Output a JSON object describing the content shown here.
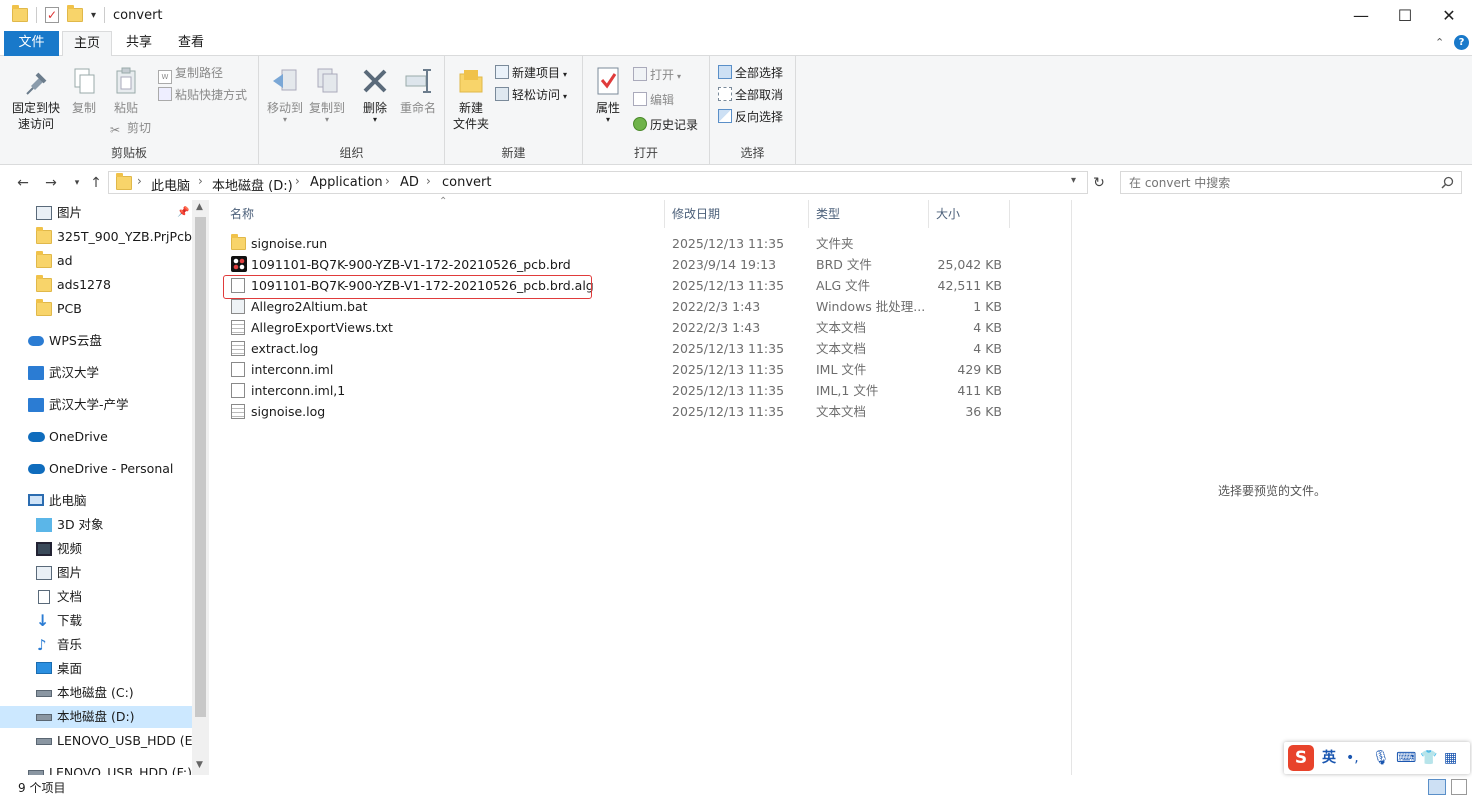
{
  "window": {
    "title": "convert",
    "controls": {
      "minimize": "—",
      "maximize": "☐",
      "close": "✕"
    }
  },
  "menu_tabs": [
    {
      "label": "文件",
      "active": false,
      "accent": true
    },
    {
      "label": "主页",
      "active": true
    },
    {
      "label": "共享",
      "active": false
    },
    {
      "label": "查看",
      "active": false
    }
  ],
  "ribbon": {
    "clipboard": {
      "label": "剪贴板",
      "pin": "固定到快\n速访问",
      "pin_l1": "固定到快",
      "pin_l2": "速访问",
      "copy": "复制",
      "paste": "粘贴",
      "copy_path": "复制路径",
      "paste_shortcut": "粘贴快捷方式",
      "cut": "剪切"
    },
    "organize": {
      "label": "组织",
      "move_to": "移动到",
      "copy_to": "复制到",
      "delete": "删除",
      "rename": "重命名"
    },
    "new": {
      "label": "新建",
      "new_item": "新建项目",
      "easy_access": "轻松访问",
      "new_folder_l1": "新建",
      "new_folder_l2": "文件夹"
    },
    "open": {
      "label": "打开",
      "properties": "属性",
      "open": "打开",
      "edit": "编辑",
      "history": "历史记录"
    },
    "select": {
      "label": "选择",
      "select_all": "全部选择",
      "select_none": "全部取消",
      "invert": "反向选择"
    }
  },
  "address": {
    "crumbs": [
      "此电脑",
      "本地磁盘 (D:)",
      "Application",
      "AD",
      "convert"
    ],
    "search_placeholder": "在 convert 中搜索"
  },
  "nav": {
    "items": [
      {
        "label": "图片",
        "icon": "pictures-icon",
        "pinned": true
      },
      {
        "label": "325T_900_YZB.PrjPcb",
        "icon": "folder-icon"
      },
      {
        "label": "ad",
        "icon": "folder-icon"
      },
      {
        "label": "ads1278",
        "icon": "folder-icon"
      },
      {
        "label": "PCB",
        "icon": "folder-icon"
      },
      {
        "label": "WPS云盘",
        "icon": "cloud-icon"
      },
      {
        "label": "武汉大学",
        "icon": "org-icon"
      },
      {
        "label": "武汉大学-产学",
        "icon": "org-icon"
      },
      {
        "label": "OneDrive",
        "icon": "onedrive-icon"
      },
      {
        "label": "OneDrive - Personal",
        "icon": "onedrive-icon"
      },
      {
        "label": "此电脑",
        "icon": "computer-icon"
      },
      {
        "label": "3D 对象",
        "icon": "3d-objects-icon"
      },
      {
        "label": "视频",
        "icon": "video-icon"
      },
      {
        "label": "图片",
        "icon": "pictures-icon"
      },
      {
        "label": "文档",
        "icon": "documents-icon"
      },
      {
        "label": "下载",
        "icon": "download-icon"
      },
      {
        "label": "音乐",
        "icon": "music-icon"
      },
      {
        "label": "桌面",
        "icon": "desktop-icon"
      },
      {
        "label": "本地磁盘 (C:)",
        "icon": "drive-c-icon"
      },
      {
        "label": "本地磁盘 (D:)",
        "icon": "drive-icon",
        "selected": true
      },
      {
        "label": "LENOVO_USB_HDD (E:)",
        "icon": "usb-drive-icon"
      },
      {
        "label": "LENOVO_USB_HDD (F:)",
        "icon": "usb-drive-icon"
      }
    ]
  },
  "columns": {
    "name": "名称",
    "modified": "修改日期",
    "type": "类型",
    "size": "大小"
  },
  "files": [
    {
      "name": "signoise.run",
      "modified": "2025/12/13 11:35",
      "type": "文件夹",
      "size": "",
      "icon": "folder-icon"
    },
    {
      "name": "1091101-BQ7K-900-YZB-V1-172-20210526_pcb.brd",
      "modified": "2023/9/14 19:13",
      "type": "BRD 文件",
      "size": "25,042 KB",
      "icon": "allegro-brd-icon"
    },
    {
      "name": "1091101-BQ7K-900-YZB-V1-172-20210526_pcb.brd.alg",
      "modified": "2025/12/13 11:35",
      "type": "ALG 文件",
      "size": "42,511 KB",
      "icon": "blank-file-icon",
      "highlighted": true
    },
    {
      "name": "Allegro2Altium.bat",
      "modified": "2022/2/3 1:43",
      "type": "Windows 批处理...",
      "size": "1 KB",
      "icon": "batch-file-icon"
    },
    {
      "name": "AllegroExportViews.txt",
      "modified": "2022/2/3 1:43",
      "type": "文本文档",
      "size": "4 KB",
      "icon": "text-file-icon"
    },
    {
      "name": "extract.log",
      "modified": "2025/12/13 11:35",
      "type": "文本文档",
      "size": "4 KB",
      "icon": "text-file-icon"
    },
    {
      "name": "interconn.iml",
      "modified": "2025/12/13 11:35",
      "type": "IML 文件",
      "size": "429 KB",
      "icon": "blank-file-icon"
    },
    {
      "name": "interconn.iml,1",
      "modified": "2025/12/13 11:35",
      "type": "IML,1 文件",
      "size": "411 KB",
      "icon": "blank-file-icon"
    },
    {
      "name": "signoise.log",
      "modified": "2025/12/13 11:35",
      "type": "文本文档",
      "size": "36 KB",
      "icon": "text-file-icon"
    }
  ],
  "preview": {
    "message": "选择要预览的文件。"
  },
  "status": {
    "count": "9 个项目"
  },
  "ime": {
    "mode": "英",
    "logo": "S"
  },
  "colors": {
    "accent": "#1979ca",
    "selection": "#cce8ff",
    "highlight_box": "#e03b3b",
    "folder": "#f8d46a"
  }
}
